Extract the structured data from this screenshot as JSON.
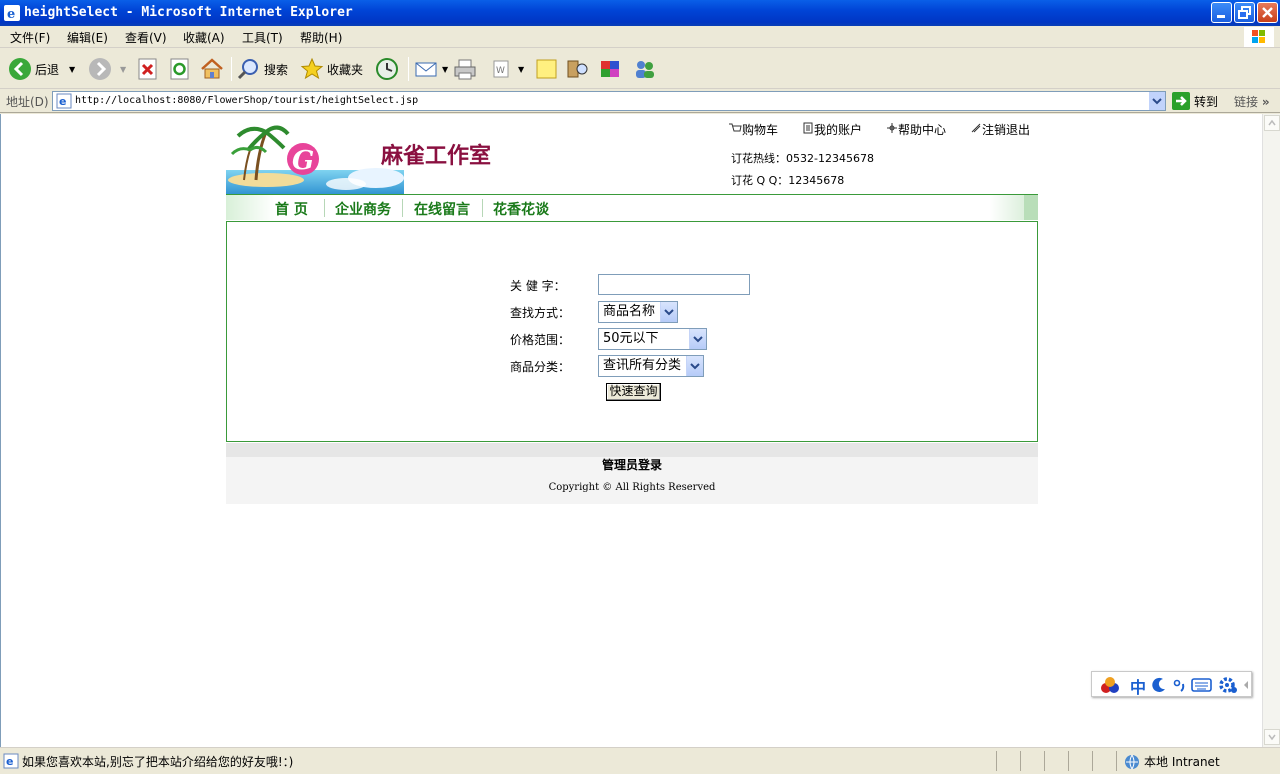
{
  "window": {
    "title": "heightSelect - Microsoft Internet Explorer"
  },
  "menu": [
    "文件(F)",
    "编辑(E)",
    "查看(V)",
    "收藏(A)",
    "工具(T)",
    "帮助(H)"
  ],
  "toolbar": {
    "back": "后退",
    "search": "搜索",
    "favorites": "收藏夹"
  },
  "address": {
    "label": "地址(D)",
    "url": "http://localhost:8080/FlowerShop/tourist/heightSelect.jsp",
    "go": "转到",
    "links": "链接"
  },
  "header": {
    "logo_text": "麻雀工作室",
    "top_links": [
      "购物车",
      "我的账户",
      "帮助中心",
      "注销退出"
    ],
    "hotline": "订花热线：0532-12345678",
    "qq": "订花 Q Q：12345678"
  },
  "nav": [
    "首 页",
    "企业商务",
    "在线留言",
    "花香花谈"
  ],
  "form": {
    "keyword_label": "关 健 字：",
    "keyword_value": "",
    "method_label": "查找方式：",
    "method_value": "商品名称",
    "price_label": "价格范围：",
    "price_value": "50元以下",
    "category_label": "商品分类：",
    "category_value": "查讯所有分类",
    "submit": "快速查询"
  },
  "footer": {
    "admin": "管理员登录",
    "copyright": "Copyright © All Rights Reserved"
  },
  "ime": {
    "mode": "中"
  },
  "status": {
    "text": "如果您喜欢本站,别忘了把本站介绍给您的好友哦!：)",
    "zone": "本地 Intranet"
  }
}
